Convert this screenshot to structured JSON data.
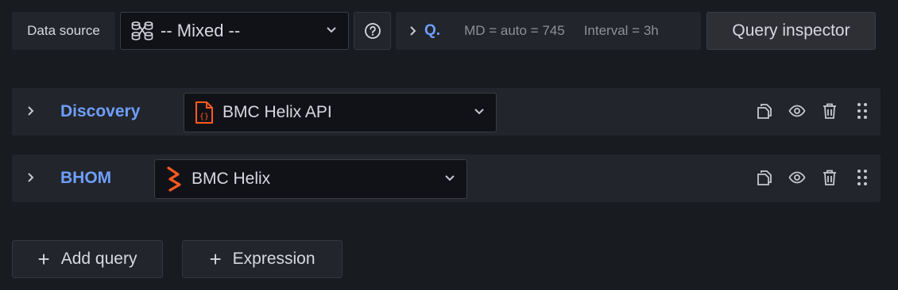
{
  "toolbar": {
    "data_source_label": "Data source",
    "data_source_value": "-- Mixed --",
    "query_options_letter": "Q.",
    "md_text": "MD = auto = 745",
    "interval_text": "Interval = 3h",
    "inspector_label": "Query inspector"
  },
  "queries": [
    {
      "ref_id": "Discovery",
      "datasource": "BMC Helix API",
      "icon": "code-braces-icon"
    },
    {
      "ref_id": "BHOM",
      "datasource": "BMC Helix",
      "icon": "bmc-helix-logo-icon"
    }
  ],
  "buttons": {
    "add_query": "Add query",
    "expression": "Expression"
  },
  "colors": {
    "background": "#181b1f",
    "panel": "#22252b",
    "accent_link": "#6e9fff",
    "helix_orange": "#ff5a1f"
  }
}
